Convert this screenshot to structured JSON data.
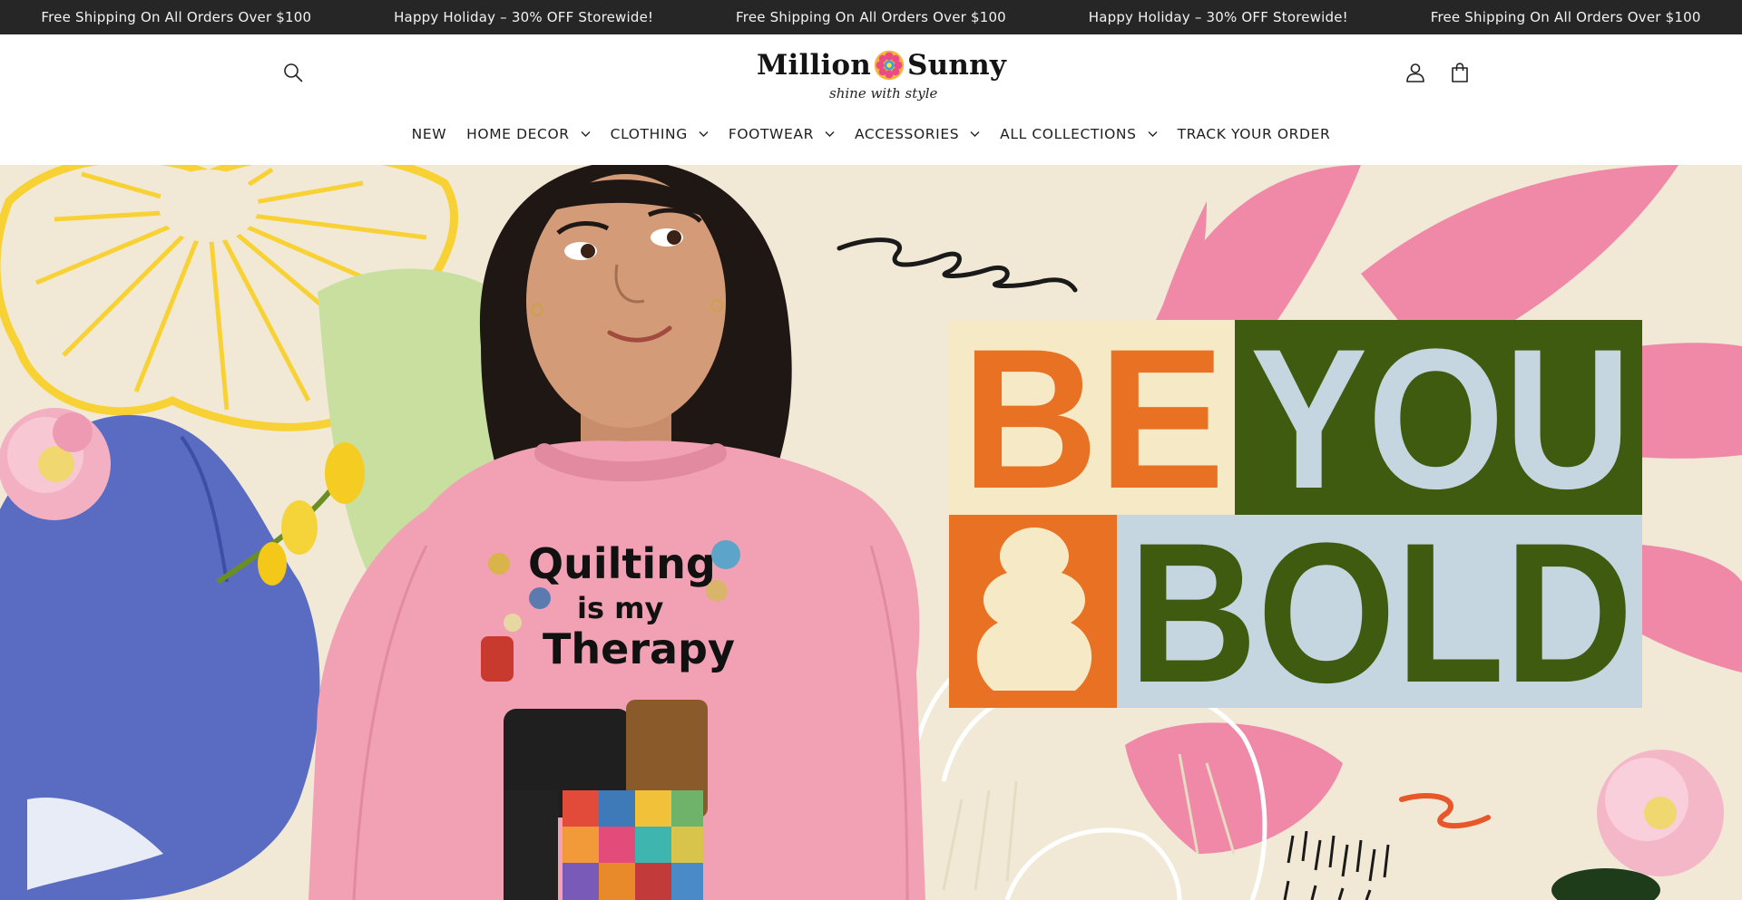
{
  "announcement": {
    "messages": [
      "Free Shipping On All Orders Over $100",
      "Happy Holiday – 30% OFF Storewide!",
      "Free Shipping On All Orders Over $100",
      "Happy Holiday – 30% OFF Storewide!",
      "Free Shipping On All Orders Over $100"
    ]
  },
  "header": {
    "logo_left": "Million",
    "logo_right": "Sunny",
    "logo_tagline": "shine with style",
    "icons": {
      "search": "search-icon",
      "account": "user-icon",
      "cart": "shopping-bag-icon"
    }
  },
  "nav": {
    "items": [
      {
        "label": "NEW",
        "dropdown": false
      },
      {
        "label": "HOME DECOR",
        "dropdown": true
      },
      {
        "label": "CLOTHING",
        "dropdown": true
      },
      {
        "label": "FOOTWEAR",
        "dropdown": true
      },
      {
        "label": "ACCESSORIES",
        "dropdown": true
      },
      {
        "label": "ALL COLLECTIONS",
        "dropdown": true
      },
      {
        "label": "TRACK YOUR ORDER",
        "dropdown": false
      }
    ]
  },
  "hero": {
    "headline_row1": [
      "BE",
      "YOU"
    ],
    "headline_row2": "BOLD",
    "shirt_text": [
      "Quilting",
      "is my",
      "Therapy"
    ]
  },
  "colors": {
    "announcement_bg": "#262626",
    "hero_bg": "#f1e9d6",
    "orange": "#e87124",
    "dark_green": "#3f5b10",
    "light_blue": "#c6d6e0",
    "cream": "#f5e9c6",
    "pink": "#f089a8",
    "yellow": "#f8d234",
    "blue": "#5a6cc2",
    "sweater_pink": "#f2a1b4"
  }
}
